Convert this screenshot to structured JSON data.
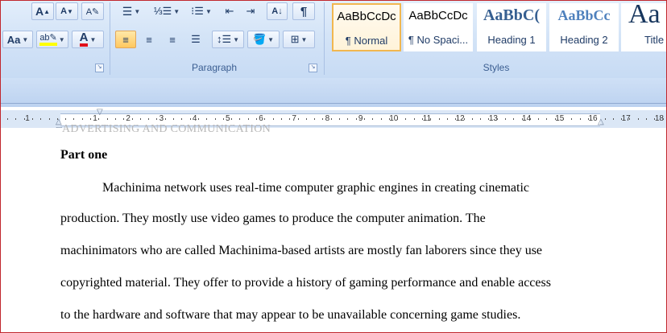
{
  "ribbon": {
    "font": {
      "grow_font_label": "A",
      "shrink_font_label": "A",
      "change_case_label": "Aa",
      "font_color_label": "A"
    },
    "paragraph": {
      "group_label": "Paragraph",
      "show_marks_label": "¶"
    },
    "styles": {
      "group_label": "Styles",
      "items": [
        {
          "preview": "AaBbCcDc",
          "name": "¶ Normal"
        },
        {
          "preview": "AaBbCcDc",
          "name": "¶ No Spaci..."
        },
        {
          "preview": "AaBbC(",
          "name": "Heading 1"
        },
        {
          "preview": "AaBbCc",
          "name": "Heading 2"
        },
        {
          "preview": "Aa",
          "name": "Title"
        }
      ]
    }
  },
  "ruler": {
    "labels": [
      "1",
      "1",
      "2",
      "3",
      "4",
      "5",
      "6",
      "7",
      "8",
      "9",
      "10",
      "11",
      "12",
      "13",
      "14",
      "15",
      "16",
      "17",
      "18"
    ]
  },
  "document": {
    "header_text": "ADVERTISING AND COMMUNICATION",
    "heading": "Part one",
    "lines": [
      "Machinima network uses real-time computer graphic engines in creating cinematic",
      "production. They mostly use video games to produce the computer animation. The",
      "machinimators who are called Machinima-based artists are mostly fan laborers since they use",
      "copyrighted material. They offer to provide a history of gaming performance and enable access",
      "to the hardware and software that may appear to be unavailable concerning game studies."
    ]
  },
  "colors": {
    "accent": "#f1b750",
    "ribbon": "#d4e4f7",
    "frame": "#c1272d"
  }
}
